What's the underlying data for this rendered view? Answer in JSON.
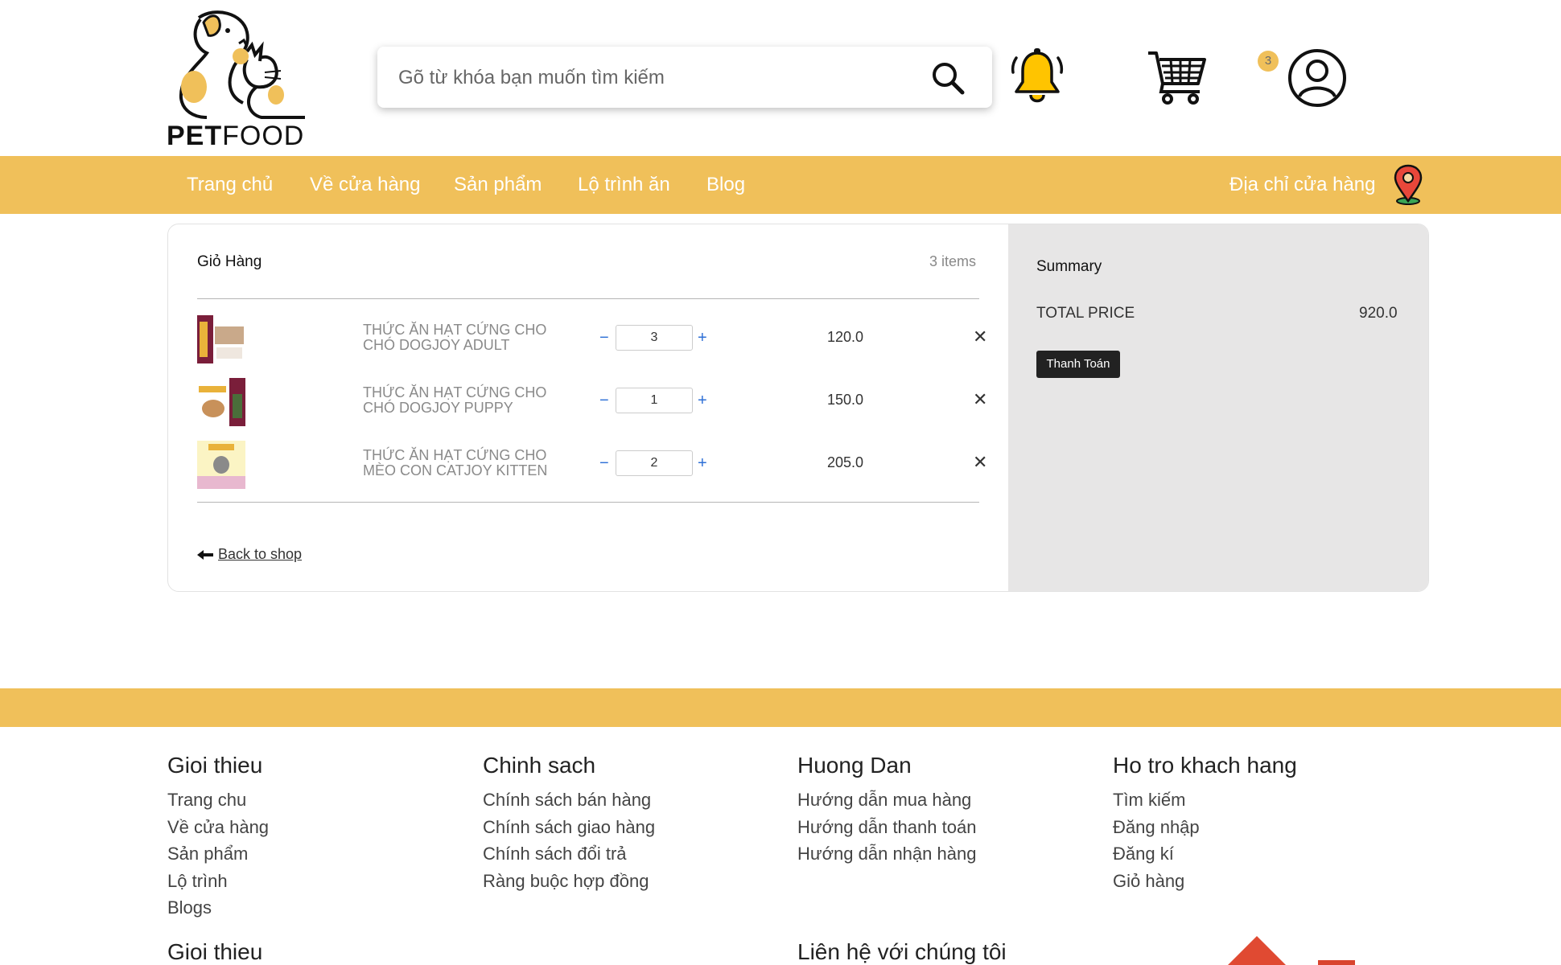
{
  "brand": {
    "logo_text_bold": "PET",
    "logo_text_thin": "FOOD"
  },
  "search": {
    "placeholder": "Gõ từ khóa bạn muốn tìm kiếm"
  },
  "header": {
    "cart_badge": "3"
  },
  "nav": {
    "items": [
      "Trang chủ",
      "Về cửa hàng",
      "Sản phẩm",
      "Lộ trình ăn",
      "Blog"
    ],
    "store_address": "Địa chỉ cửa hàng"
  },
  "cart": {
    "title": "Giỏ Hàng",
    "count_label": "3 items",
    "items": [
      {
        "name_line1": "THỨC ĂN HẠT CỨNG CHO",
        "name_line2": "CHÓ DOGJOY ADULT",
        "qty": "3",
        "price": "120.0"
      },
      {
        "name_line1": "THỨC ĂN HẠT CỨNG CHO",
        "name_line2": "CHÓ DOGJOY PUPPY",
        "qty": "1",
        "price": "150.0"
      },
      {
        "name_line1": "THỨC ĂN HẠT CỨNG CHO",
        "name_line2": "MÈO CON CATJOY KITTEN",
        "qty": "2",
        "price": "205.0"
      }
    ],
    "minus": "−",
    "plus": "+",
    "remove": "✕",
    "back_label": "Back to shop"
  },
  "summary": {
    "title": "Summary",
    "total_label": "TOTAL PRICE",
    "total_value": "920.0",
    "pay_label": "Thanh Toán"
  },
  "footer": {
    "columns": [
      {
        "heading": "Gioi thieu",
        "links": [
          "Trang chu",
          "Về cửa hàng",
          "Sản phẩm",
          "Lộ trình",
          "Blogs"
        ]
      },
      {
        "heading": "Chinh sach",
        "links": [
          "Chính sách bán hàng",
          "Chính sách giao hàng",
          "Chính sách đổi trả",
          "Ràng buộc hợp đồng"
        ]
      },
      {
        "heading": "Huong Dan",
        "links": [
          "Hướng dẫn mua hàng",
          "Hướng dẫn thanh toán",
          "Hướng dẫn nhận hàng"
        ]
      },
      {
        "heading": "Ho tro khach hang",
        "links": [
          "Tìm kiếm",
          "Đăng nhập",
          "Đăng kí",
          "Giỏ hàng"
        ]
      }
    ],
    "bottom_heading_left": "Gioi thieu",
    "bottom_heading_mid": "Liên hệ với chúng tôi"
  },
  "colors": {
    "accent": "#f0c05a",
    "remove_accent": "#e04a32"
  },
  "icons": [
    "pet-logo-icon",
    "search-icon",
    "bell-icon",
    "cart-icon",
    "user-icon",
    "map-pin-icon",
    "arrow-left-icon"
  ]
}
